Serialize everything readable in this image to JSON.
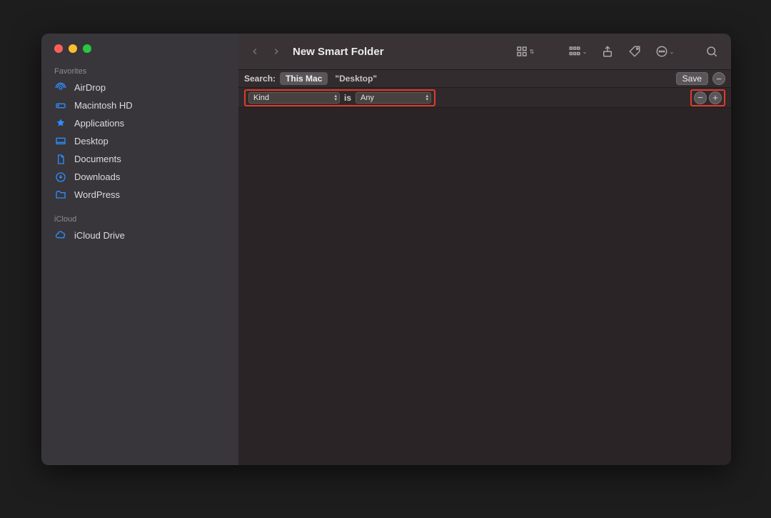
{
  "window": {
    "title": "New Smart Folder"
  },
  "sidebar": {
    "sections": [
      {
        "label": "Favorites",
        "items": [
          {
            "icon": "airdrop",
            "label": "AirDrop"
          },
          {
            "icon": "hdd",
            "label": "Macintosh HD"
          },
          {
            "icon": "apps",
            "label": "Applications"
          },
          {
            "icon": "desktop",
            "label": "Desktop"
          },
          {
            "icon": "doc",
            "label": "Documents"
          },
          {
            "icon": "download",
            "label": "Downloads"
          },
          {
            "icon": "folder",
            "label": "WordPress"
          }
        ]
      },
      {
        "label": "iCloud",
        "items": [
          {
            "icon": "cloud",
            "label": "iCloud Drive"
          }
        ]
      }
    ]
  },
  "scopebar": {
    "label": "Search:",
    "active": "This Mac",
    "alt": "\"Desktop\"",
    "save_label": "Save"
  },
  "criteria": {
    "attr": "Kind",
    "op": "is",
    "value": "Any"
  }
}
